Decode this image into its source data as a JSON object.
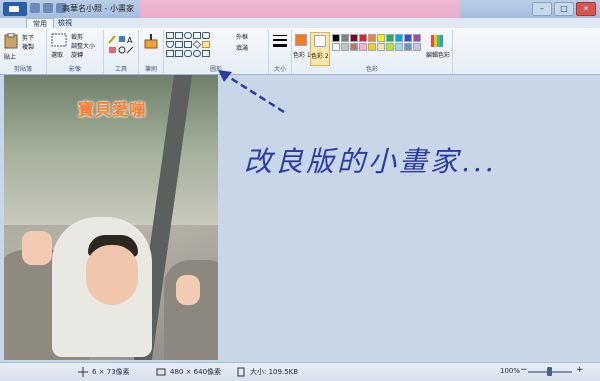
{
  "window": {
    "title": "高華名小照 - 小畫家"
  },
  "tabs": [
    {
      "label": "常用"
    },
    {
      "label": "檢視"
    }
  ],
  "ribbon": {
    "clipboard": {
      "paste": "貼上",
      "cut": "剪下",
      "copy": "複製",
      "label": "剪貼簿"
    },
    "image": {
      "select": "選取",
      "crop": "裁剪",
      "resize": "調整大小",
      "rotate": "旋轉",
      "label": "影像"
    },
    "tools": {
      "label": "工具"
    },
    "brushes": {
      "label": "筆刷"
    },
    "shapes": {
      "outline": "外框",
      "fill": "填滿",
      "label": "圖形"
    },
    "size": {
      "label": "大小"
    },
    "colors": {
      "color1": "色彩 1",
      "color2": "色彩 2",
      "edit": "編輯色彩",
      "label": "色彩",
      "palette_row1": [
        "#000000",
        "#7f7f7f",
        "#880015",
        "#ed1c24",
        "#ff7f27",
        "#fff200",
        "#22b14c",
        "#00a2e8",
        "#3f48cc",
        "#a349a4"
      ],
      "palette_row2": [
        "#ffffff",
        "#c3c3c3",
        "#b97a57",
        "#ffaec9",
        "#ffc90e",
        "#efe4b0",
        "#b5e61d",
        "#99d9ea",
        "#7092be",
        "#c8bfe7"
      ],
      "color1_value": "#f47b20",
      "color2_value": "#ffffff"
    }
  },
  "canvas": {
    "photo_caption": "寶貝愛嘣",
    "annotation": "改良版的小畫家..."
  },
  "status": {
    "cursor": "6 × 73像素",
    "dimensions": "480 × 640像素",
    "filesize": "大小: 109.5KB",
    "zoom": "100%"
  }
}
